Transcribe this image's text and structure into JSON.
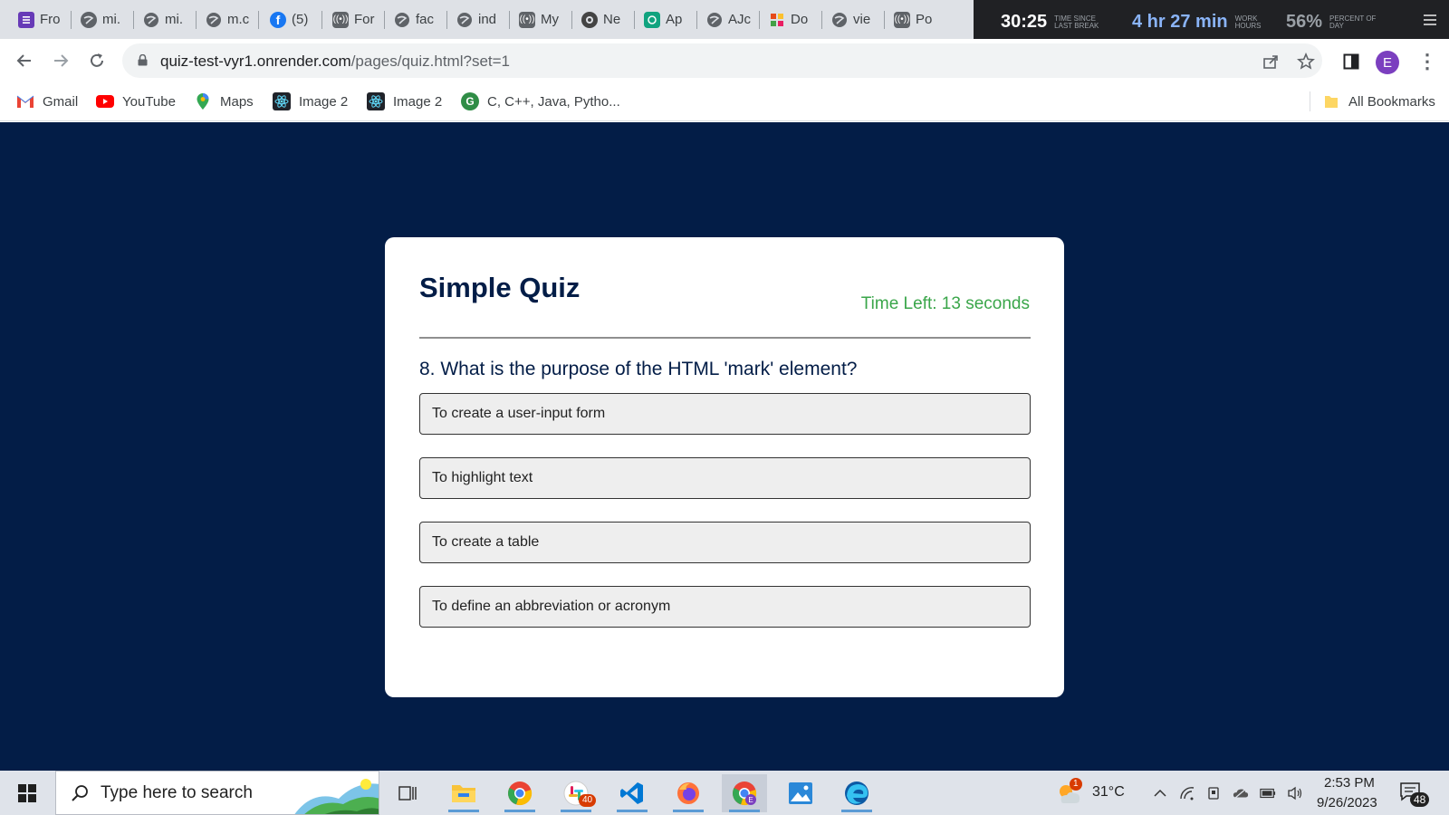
{
  "browser": {
    "tabs": [
      {
        "label": "Fro",
        "icon": "forms-icon"
      },
      {
        "label": "mi.",
        "icon": "globe-icon"
      },
      {
        "label": "mi.",
        "icon": "globe-icon"
      },
      {
        "label": "m.c",
        "icon": "globe-icon"
      },
      {
        "label": "(5)",
        "icon": "facebook-icon"
      },
      {
        "label": "For",
        "icon": "broadcast-icon"
      },
      {
        "label": "fac",
        "icon": "globe-icon"
      },
      {
        "label": "ind",
        "icon": "globe-icon"
      },
      {
        "label": "My",
        "icon": "broadcast-icon"
      },
      {
        "label": "Ne",
        "icon": "github-icon"
      },
      {
        "label": "Ap",
        "icon": "chatgpt-icon"
      },
      {
        "label": "AJc",
        "icon": "globe-icon"
      },
      {
        "label": "Do",
        "icon": "grid-icon"
      },
      {
        "label": "vie",
        "icon": "globe-icon"
      },
      {
        "label": "Po",
        "icon": "broadcast-icon"
      }
    ],
    "url_host": "quiz-test-vyr1.onrender.com",
    "url_path": "/pages/quiz.html?set=1",
    "profile_initial": "E",
    "bookmarks": [
      {
        "label": "Gmail",
        "icon": "gmail-icon"
      },
      {
        "label": "YouTube",
        "icon": "youtube-icon"
      },
      {
        "label": "Maps",
        "icon": "maps-icon"
      },
      {
        "label": "Image 2",
        "icon": "react-icon"
      },
      {
        "label": "Image 2",
        "icon": "react-icon"
      },
      {
        "label": "C, C++, Java, Pytho...",
        "icon": "leaf-icon"
      }
    ],
    "all_bookmarks": "All Bookmarks"
  },
  "tracker": {
    "break_time": "30:25",
    "break_label": "TIME SINCE LAST BREAK",
    "work_time": "4 hr 27 min",
    "work_label": "WORK HOURS",
    "percent": "56%",
    "percent_label": "PERCENT OF DAY"
  },
  "quiz": {
    "title": "Simple Quiz",
    "timer": "Time Left: 13 seconds",
    "question": "8. What is the purpose of the HTML 'mark' element?",
    "options": [
      "To create a user-input form",
      "To highlight text",
      "To create a table",
      "To define an abbreviation or acronym"
    ]
  },
  "taskbar": {
    "search_placeholder": "Type here to search",
    "apps": [
      "task-view",
      "file-explorer",
      "chrome",
      "slack",
      "vscode",
      "firefox",
      "chrome-profile",
      "photos",
      "edge"
    ],
    "slack_badge": "40",
    "weather_badge": "1",
    "temperature": "31°C",
    "time": "2:53 PM",
    "date": "9/26/2023",
    "notifications": "48"
  },
  "colors": {
    "page_bg": "#031d47",
    "timer": "#3aa64a",
    "card": "#ffffff",
    "option_bg": "#eeeeee"
  }
}
